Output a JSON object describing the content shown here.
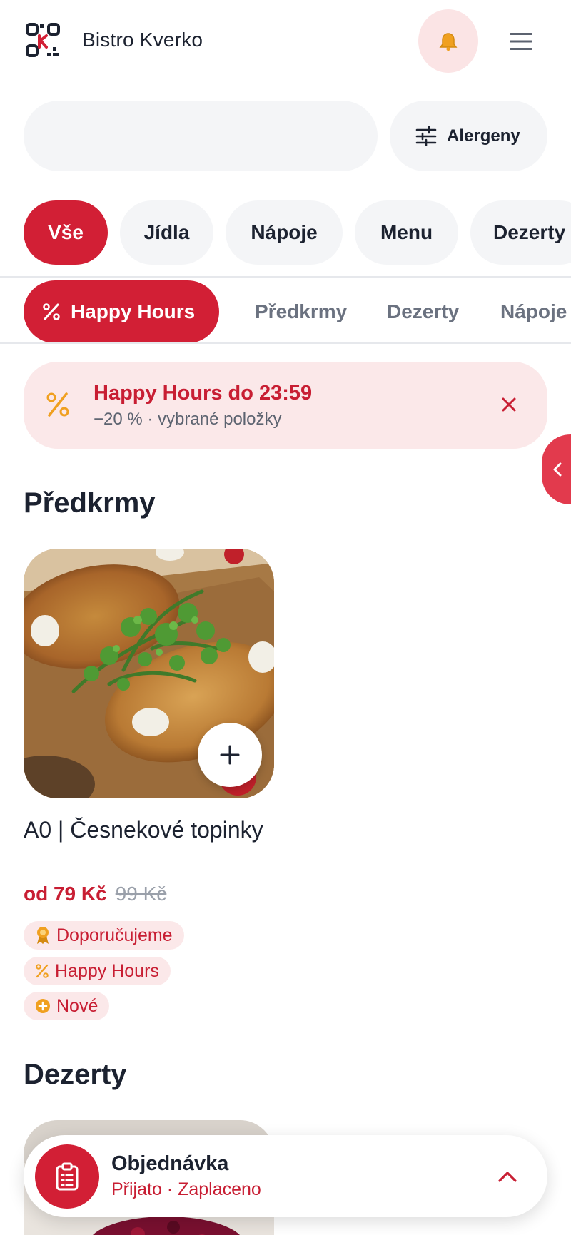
{
  "header": {
    "brand": "Bistro Kverko",
    "logo_icon": "qr-logo-icon",
    "bell_icon": "bell-icon",
    "menu_icon": "hamburger-menu-icon"
  },
  "search": {
    "value": "",
    "placeholder": ""
  },
  "allergens": {
    "label": "Alergeny",
    "icon": "sliders-icon"
  },
  "categories": [
    {
      "label": "Vše",
      "active": true
    },
    {
      "label": "Jídla",
      "active": false
    },
    {
      "label": "Nápoje",
      "active": false
    },
    {
      "label": "Menu",
      "active": false
    },
    {
      "label": "Dezerty",
      "active": false
    }
  ],
  "subtabs": [
    {
      "label": "Happy Hours",
      "active": true,
      "icon": "percent-icon"
    },
    {
      "label": "Předkrmy",
      "active": false
    },
    {
      "label": "Dezerty",
      "active": false
    },
    {
      "label": "Nápoje",
      "active": false
    }
  ],
  "banner": {
    "title": "Happy Hours do 23:59",
    "subtitle": "−20 % · vybrané položky",
    "icon": "percent-icon",
    "close_icon": "close-icon"
  },
  "sections": [
    {
      "title": "Předkrmy",
      "items": [
        {
          "name": "A0 | Česnekové topinky",
          "price": "od 79 Kč",
          "old_price": "99 Kč",
          "badges": [
            {
              "label": "Doporučujeme",
              "icon": "award-icon"
            },
            {
              "label": "Happy Hours",
              "icon": "percent-icon"
            },
            {
              "label": "Nové",
              "icon": "plus-circle-icon"
            }
          ]
        }
      ]
    },
    {
      "title": "Dezerty"
    }
  ],
  "order": {
    "title": "Objednávka",
    "status": "Přijato · Zaplaceno",
    "icon": "clipboard-icon",
    "toggle_icon": "chevron-up-icon"
  },
  "colors": {
    "accent": "#d21f35",
    "accent_light": "#fbe8e9",
    "chip_bg": "#f4f5f7",
    "text": "#1c2230",
    "muted": "#6b7280",
    "amber": "#f0a020"
  }
}
